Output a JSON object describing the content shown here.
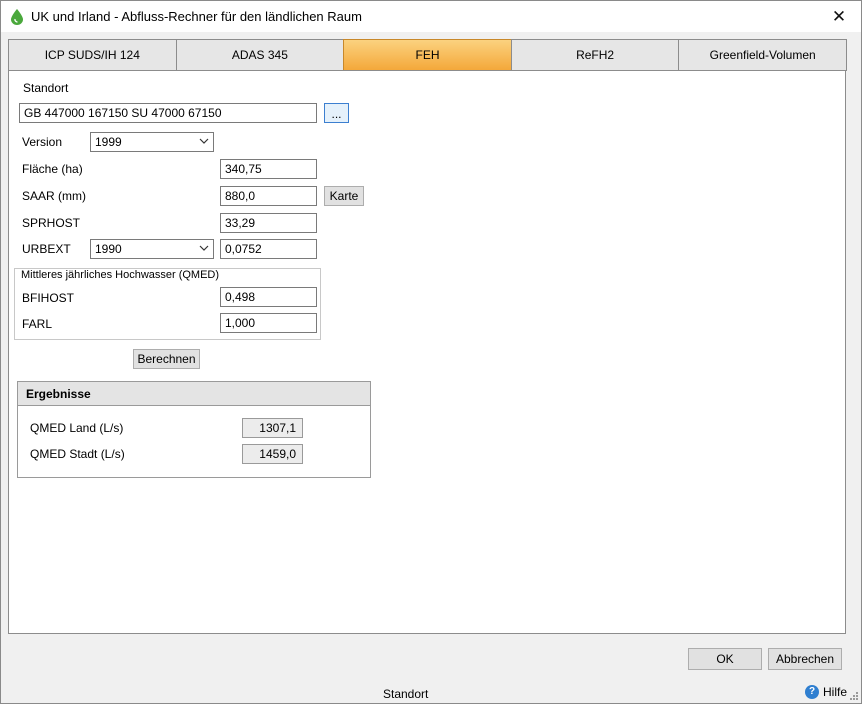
{
  "window": {
    "title": "UK und Irland - Abfluss-Rechner für den ländlichen Raum",
    "close_glyph": "✕"
  },
  "tabs": [
    {
      "label": "ICP SUDS/IH 124"
    },
    {
      "label": "ADAS 345"
    },
    {
      "label": "FEH",
      "active": true
    },
    {
      "label": "ReFH2"
    },
    {
      "label": "Greenfield-Volumen"
    }
  ],
  "accent_color": "#f4a83a",
  "form": {
    "standort_label": "Standort",
    "standort_value": "GB 447000 167150 SU 47000 67150",
    "browse_label": "...",
    "version_label": "Version",
    "version_value": "1999",
    "flaeche_label": "Fläche (ha)",
    "flaeche_value": "340,75",
    "saar_label": "SAAR (mm)",
    "saar_value": "880,0",
    "karte_label": "Karte",
    "sprhost_label": "SPRHOST",
    "sprhost_value": "33,29",
    "urbext_label": "URBEXT",
    "urbext_year": "1990",
    "urbext_value": "0,0752"
  },
  "qmed_group": {
    "title": "Mittleres jährliches Hochwasser (QMED)",
    "bfihost_label": "BFIHOST",
    "bfihost_value": "0,498",
    "farl_label": "FARL",
    "farl_value": "1,000"
  },
  "calculate_label": "Berechnen",
  "results": {
    "title": "Ergebnisse",
    "qmed_land_label": "QMED Land (L/s)",
    "qmed_land_value": "1307,1",
    "qmed_stadt_label": "QMED Stadt (L/s)",
    "qmed_stadt_value": "1459,0"
  },
  "footer": {
    "ok_label": "OK",
    "cancel_label": "Abbrechen",
    "status_text": "Standort",
    "help_label": "Hilfe",
    "help_glyph": "?"
  },
  "icons": [
    "water-drop-icon",
    "close-icon",
    "chevron-down-icon",
    "help-icon",
    "resize-grip-icon"
  ]
}
